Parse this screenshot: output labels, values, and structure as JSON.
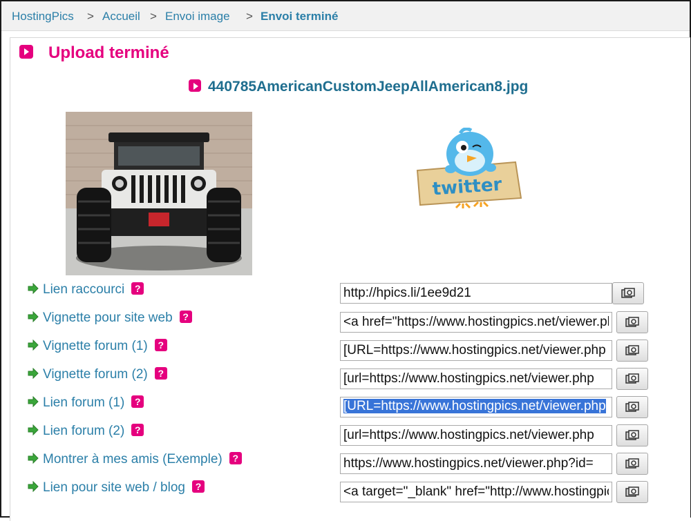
{
  "breadcrumb": {
    "items": [
      "HostingPics",
      "Accueil",
      "Envoi image",
      "Envoi terminé"
    ],
    "separator": ">"
  },
  "page": {
    "title": "Upload terminé",
    "filename": "440785AmericanCustomJeepAllAmerican8.jpg"
  },
  "twitter": {
    "label": "twitter"
  },
  "help_icon": "?",
  "rows": [
    {
      "label": "Lien raccourci",
      "value": "http://hpics.li/1ee9d21"
    },
    {
      "label": "Vignette pour site web",
      "value": "<a href=\"https://www.hostingpics.net/viewer.php"
    },
    {
      "label": "Vignette forum (1)",
      "value": "[URL=https://www.hostingpics.net/viewer.php"
    },
    {
      "label": "Vignette forum (2)",
      "value": "[url=https://www.hostingpics.net/viewer.php"
    },
    {
      "label": "Lien forum (1)",
      "value": "[URL=https://www.hostingpics.net/viewer.php"
    },
    {
      "label": "Lien forum (2)",
      "value": "[url=https://www.hostingpics.net/viewer.php"
    },
    {
      "label": "Montrer à mes amis",
      "extra": "(Exemple)",
      "value": "https://www.hostingpics.net/viewer.php?id="
    },
    {
      "label": "Lien pour site web / blog",
      "value": "<a target=\"_blank\" href=\"http://www.hostingpics"
    }
  ],
  "colors": {
    "accent_pink": "#e5007e",
    "link_blue": "#2b7fa8",
    "selection_blue": "#3874d8",
    "arrow_green": "#3aa63a"
  },
  "icons": {
    "title_bullet": "play-icon",
    "row_bullet": "green-arrow-icon",
    "copy": "clipboard-copy-icon"
  }
}
